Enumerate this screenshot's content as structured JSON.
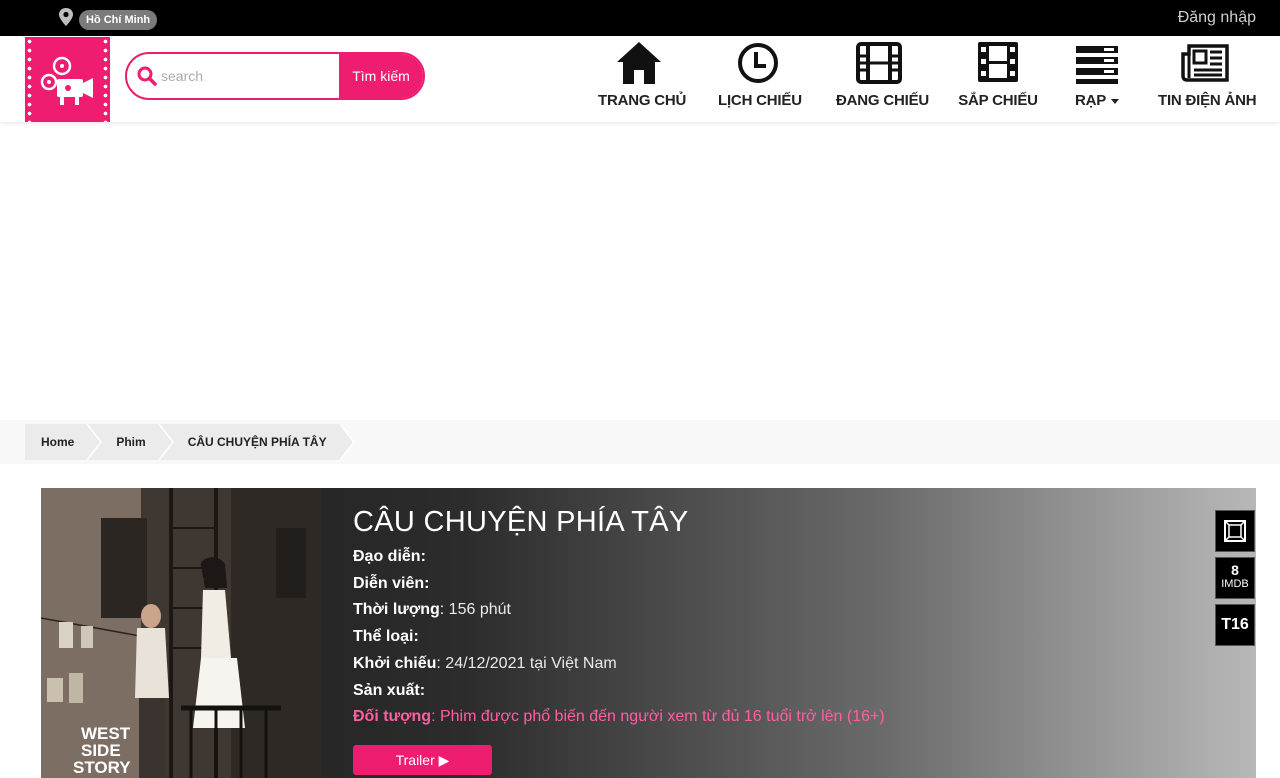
{
  "topbar": {
    "city": "Hồ Chí Minh",
    "login_label": "Đăng nhập"
  },
  "search": {
    "placeholder": "search",
    "button_label": "Tìm kiếm"
  },
  "nav": {
    "items": [
      {
        "label": "TRANG CHỦ",
        "icon": "home-icon"
      },
      {
        "label": "LỊCH CHIẾU",
        "icon": "clock-icon"
      },
      {
        "label": "ĐANG CHIẾU",
        "icon": "film-icon"
      },
      {
        "label": "SẮP CHIẾU",
        "icon": "film-strip-icon"
      },
      {
        "label": "RẠP",
        "icon": "theater-list-icon"
      },
      {
        "label": "TIN ĐIỆN ẢNH",
        "icon": "newspaper-icon"
      }
    ]
  },
  "breadcrumb": {
    "items": [
      "Home",
      "Phim",
      "CÂU CHUYỆN PHÍA TÂY"
    ]
  },
  "movie": {
    "title": "CÂU CHUYỆN PHÍA TÂY",
    "director_label": "Đạo diễn",
    "director": "",
    "cast_label": "Diễn viên",
    "cast": "",
    "duration_label": "Thời lượng",
    "duration": "156 phút",
    "genre_label": "Thể loại",
    "genre": "",
    "release_label": "Khởi chiếu",
    "release": "24/12/2021 tại Việt Nam",
    "producer_label": "Sản xuất",
    "producer": "",
    "audience_label": "Đối tượng",
    "audience": "Phim được phổ biến đến người xem từ đủ 16 tuổi trở lên (16+)",
    "trailer_label": "Trailer ▶",
    "poster_text": [
      "WEST",
      "SIDE",
      "STORY"
    ],
    "imdb_score": "8",
    "imdb_label": "IMDB",
    "age_rating": "T16"
  },
  "colors": {
    "brand": "#ee1d6f",
    "audience_text": "#ff5fa2"
  }
}
